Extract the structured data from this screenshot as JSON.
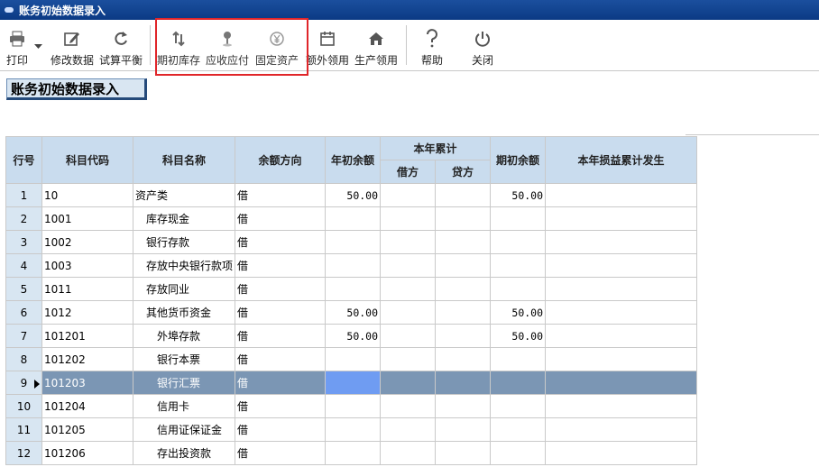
{
  "window": {
    "title": "账务初始数据录入"
  },
  "toolbar": {
    "print_label": "打印",
    "edit_label": "修改数据",
    "balance_label": "试算平衡",
    "inventory_label": "期初库存",
    "receivable_label": "应收应付",
    "fixed_assets_label": "固定资产",
    "extra_use_label": "额外领用",
    "production_use_label": "生产领用",
    "help_label": "帮助",
    "close_label": "关闭"
  },
  "page": {
    "heading": "账务初始数据录入"
  },
  "table": {
    "headers": {
      "row_no": "行号",
      "code": "科目代码",
      "name": "科目名称",
      "direction": "余额方向",
      "opening": "年初余额",
      "ytd": "本年累计",
      "debit": "借方",
      "credit": "贷方",
      "period_opening": "期初余额",
      "pl_ytd": "本年损益累计发生"
    },
    "rows": [
      {
        "no": "1",
        "code": "10",
        "name": "资产类",
        "dir": "借",
        "opening": "50.00",
        "debit": "",
        "credit": "",
        "period": "50.00",
        "pl": ""
      },
      {
        "no": "2",
        "code": "1001",
        "name": "库存现金",
        "dir": "借",
        "opening": "",
        "debit": "",
        "credit": "",
        "period": "",
        "pl": ""
      },
      {
        "no": "3",
        "code": "1002",
        "name": "银行存款",
        "dir": "借",
        "opening": "",
        "debit": "",
        "credit": "",
        "period": "",
        "pl": ""
      },
      {
        "no": "4",
        "code": "1003",
        "name": "存放中央银行款项",
        "dir": "借",
        "opening": "",
        "debit": "",
        "credit": "",
        "period": "",
        "pl": ""
      },
      {
        "no": "5",
        "code": "1011",
        "name": "存放同业",
        "dir": "借",
        "opening": "",
        "debit": "",
        "credit": "",
        "period": "",
        "pl": ""
      },
      {
        "no": "6",
        "code": "1012",
        "name": "其他货币资金",
        "dir": "借",
        "opening": "50.00",
        "debit": "",
        "credit": "",
        "period": "50.00",
        "pl": ""
      },
      {
        "no": "7",
        "code": "101201",
        "name": "外埠存款",
        "dir": "借",
        "opening": "50.00",
        "debit": "",
        "credit": "",
        "period": "50.00",
        "pl": ""
      },
      {
        "no": "8",
        "code": "101202",
        "name": "银行本票",
        "dir": "借",
        "opening": "",
        "debit": "",
        "credit": "",
        "period": "",
        "pl": ""
      },
      {
        "no": "9",
        "code": "101203",
        "name": "银行汇票",
        "dir": "借",
        "opening": "",
        "debit": "",
        "credit": "",
        "period": "",
        "pl": ""
      },
      {
        "no": "10",
        "code": "101204",
        "name": "信用卡",
        "dir": "借",
        "opening": "",
        "debit": "",
        "credit": "",
        "period": "",
        "pl": ""
      },
      {
        "no": "11",
        "code": "101205",
        "name": "信用证保证金",
        "dir": "借",
        "opening": "",
        "debit": "",
        "credit": "",
        "period": "",
        "pl": ""
      },
      {
        "no": "12",
        "code": "101206",
        "name": "存出投资款",
        "dir": "借",
        "opening": "",
        "debit": "",
        "credit": "",
        "period": "",
        "pl": ""
      }
    ],
    "selected_row": 9
  },
  "colors": {
    "titlebar": "#0b3a84",
    "header_bg": "#c9dcee",
    "selected_row": "#7b96b4",
    "selected_cell": "#6f9cf2",
    "highlight_box": "#e0262a"
  }
}
